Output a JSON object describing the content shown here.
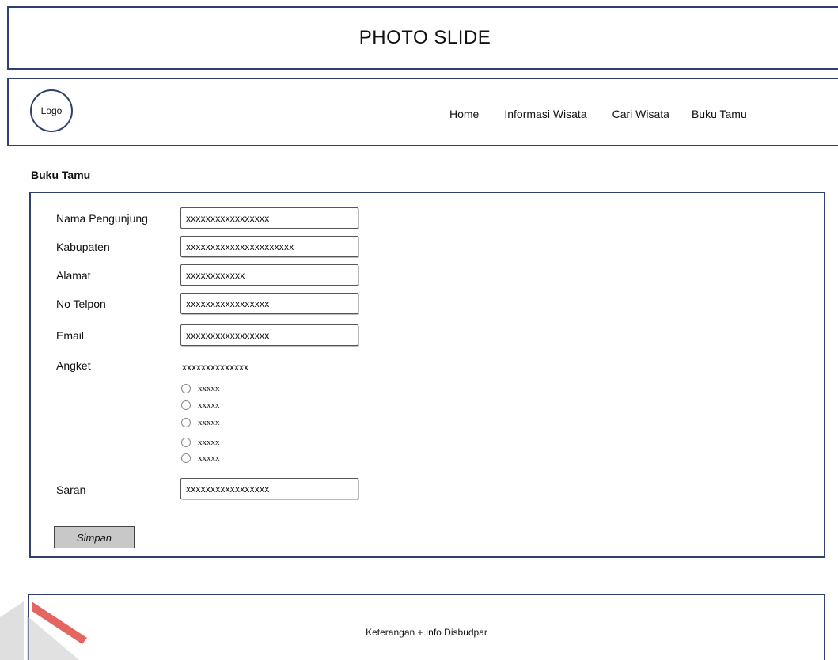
{
  "header": {
    "slide_title": "PHOTO SLIDE"
  },
  "nav": {
    "logo_label": "Logo",
    "items": [
      {
        "label": "Home"
      },
      {
        "label": "Informasi Wisata"
      },
      {
        "label": "Cari Wisata"
      },
      {
        "label": "Buku Tamu"
      }
    ]
  },
  "main": {
    "section_title": "Buku Tamu",
    "form": {
      "fields": [
        {
          "label": "Nama Pengunjung",
          "value": "xxxxxxxxxxxxxxxxx"
        },
        {
          "label": "Kabupaten",
          "value": "xxxxxxxxxxxxxxxxxxxxxx"
        },
        {
          "label": "Alamat",
          "value": "xxxxxxxxxxxx"
        },
        {
          "label": "No Telpon",
          "value": "xxxxxxxxxxxxxxxxx"
        },
        {
          "label": "Email",
          "value": "xxxxxxxxxxxxxxxxx"
        }
      ],
      "angket": {
        "label": "Angket",
        "question": "xxxxxxxxxxxxxx",
        "options": [
          {
            "label": "xxxxx"
          },
          {
            "label": "xxxxx"
          },
          {
            "label": "xxxxx"
          },
          {
            "label": "xxxxx"
          },
          {
            "label": "xxxxx"
          }
        ]
      },
      "saran": {
        "label": "Saran",
        "value": "xxxxxxxxxxxxxxxxx"
      },
      "save_label": "Simpan"
    }
  },
  "footer": {
    "text": "Keterangan + Info Disbudpar"
  },
  "colors": {
    "border": "#2f3f6e",
    "button_bg": "#c8c8c8",
    "watermark_red": "#d9342b",
    "watermark_gray": "#c9c9c9"
  }
}
